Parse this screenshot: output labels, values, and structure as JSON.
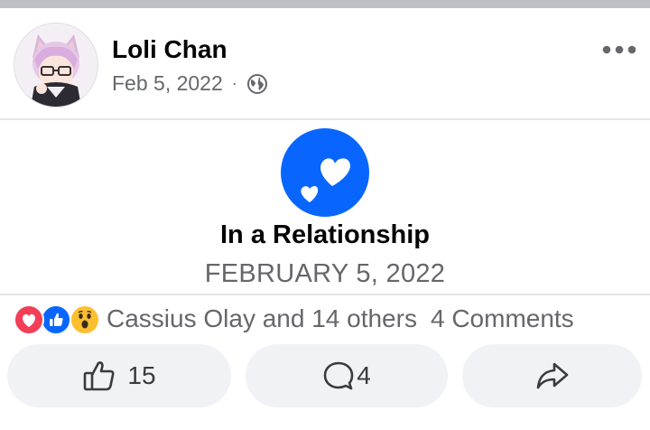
{
  "post": {
    "author_name": "Loli Chan",
    "date": "Feb 5, 2022",
    "separator": "·",
    "audience_icon": "globe-icon",
    "more_icon": "more-horizontal-icon"
  },
  "life_event": {
    "icon": "hearts-icon",
    "title": "In a Relationship",
    "date": "FEBRUARY 5, 2022"
  },
  "reactions": {
    "icons": [
      "love-reaction-icon",
      "like-reaction-icon",
      "wow-reaction-icon"
    ],
    "summary": "Cassius Olay and 14 others",
    "comments": "4 Comments"
  },
  "actions": {
    "like_count": "15",
    "comment_count": "4",
    "share_icon": "share-icon"
  },
  "colors": {
    "brand_blue": "#0866ff",
    "love_red": "#f33e58",
    "wow_yellow": "#fcbf2f",
    "secondary_text": "#65676b",
    "button_bg": "#f0f2f5"
  }
}
